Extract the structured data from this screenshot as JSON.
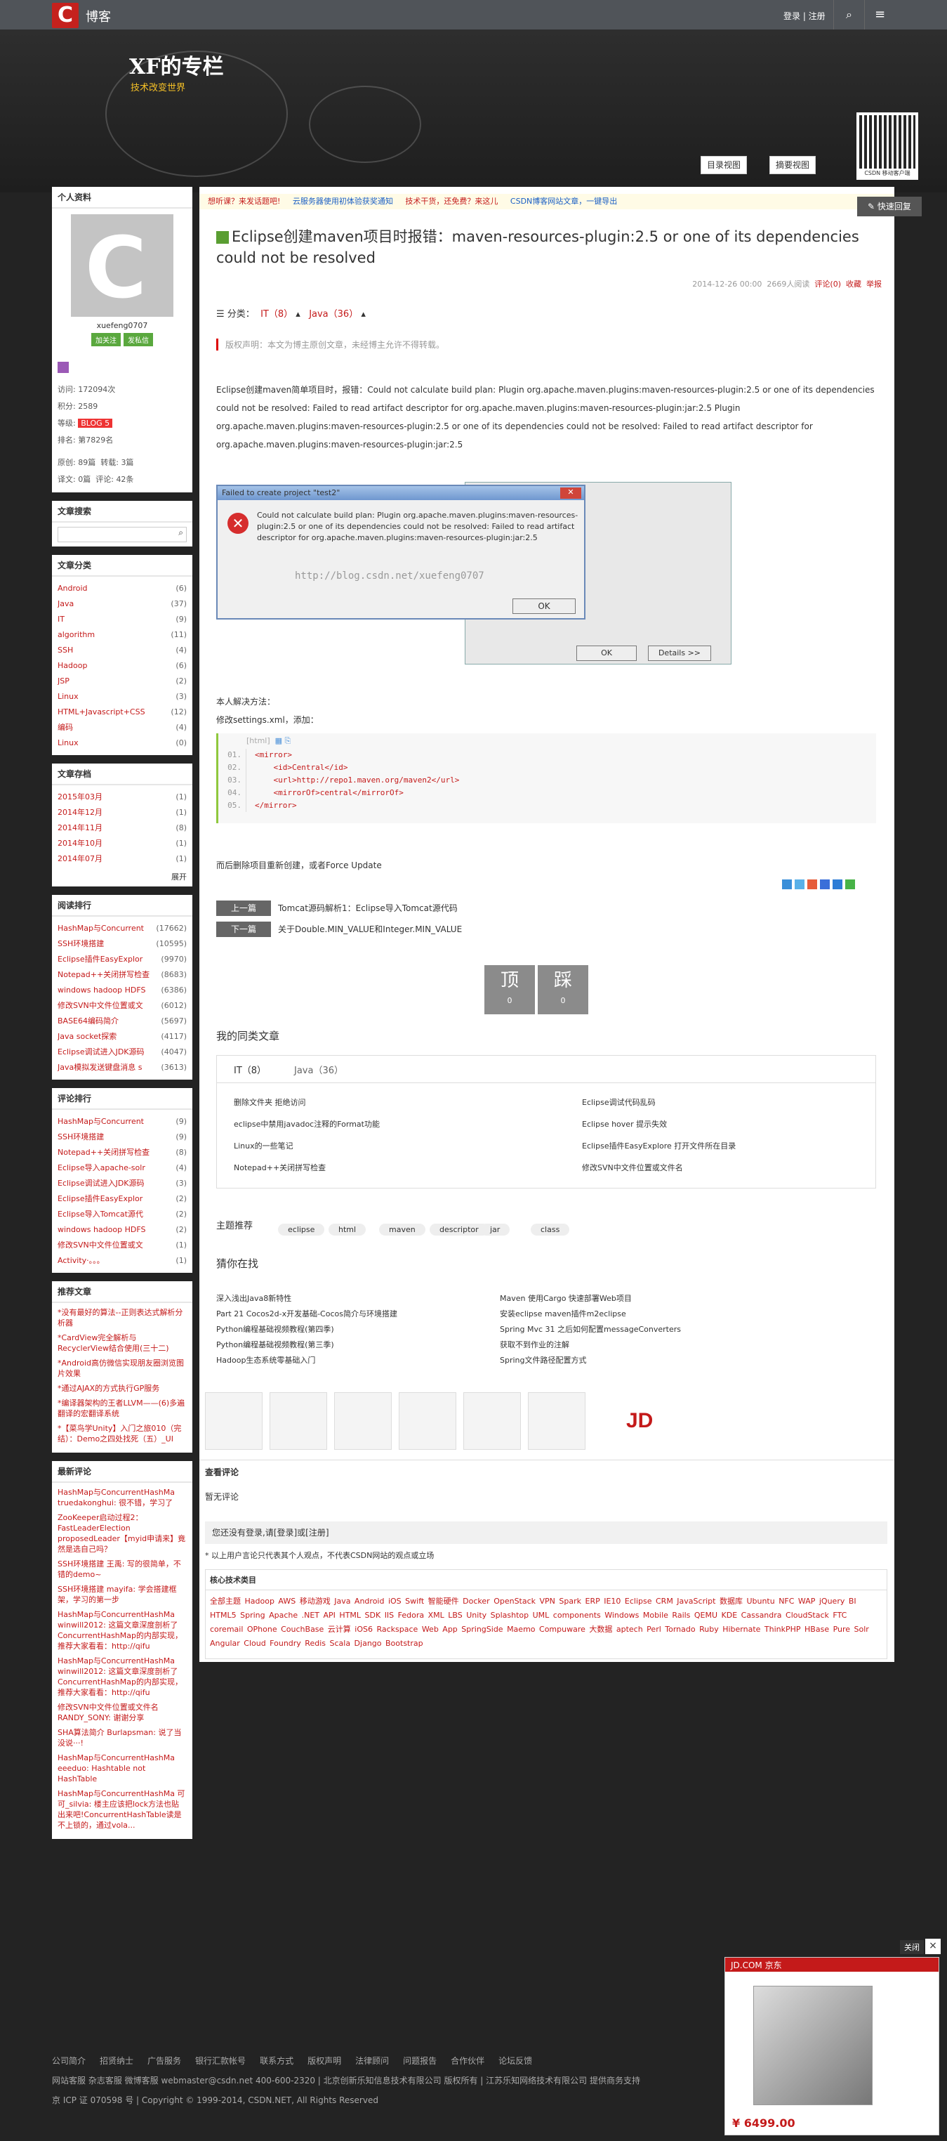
{
  "topbar": {
    "site": "博客",
    "login": "登录 | 注册",
    "search_icon": "search-icon",
    "menu_icon": "menu-icon"
  },
  "banner": {
    "title": "XF的专栏",
    "subtitle": "技术改变世界",
    "view_list": "目录视图",
    "view_summary": "摘要视图",
    "qr_caption": "CSDN 移动客户端"
  },
  "sidebar": {
    "profile": {
      "heading": "个人资料",
      "username": "xuefeng0707",
      "follow": "加关注",
      "message": "发私信",
      "visits_label": "访问:",
      "visits": "172094次",
      "points_label": "积分:",
      "points": "2589",
      "level_label": "等级:",
      "level": "BLOG 5",
      "rank_label": "排名:",
      "rank": "第7829名",
      "original_label": "原创:",
      "original": "89篇",
      "repost_label": "转载:",
      "repost": "3篇",
      "translate_label": "译文:",
      "translate": "0篇",
      "comments_label": "评论:",
      "comments": "42条"
    },
    "search": {
      "heading": "文章搜索"
    },
    "categories": {
      "heading": "文章分类",
      "items": [
        {
          "label": "Android",
          "count": "(6)"
        },
        {
          "label": "Java",
          "count": "(37)"
        },
        {
          "label": "IT",
          "count": "(9)"
        },
        {
          "label": "algorithm",
          "count": "(11)"
        },
        {
          "label": "SSH",
          "count": "(4)"
        },
        {
          "label": "Hadoop",
          "count": "(6)"
        },
        {
          "label": "JSP",
          "count": "(2)"
        },
        {
          "label": "Linux",
          "count": "(3)"
        },
        {
          "label": "HTML+Javascript+CSS",
          "count": "(12)"
        },
        {
          "label": "编码",
          "count": "(4)"
        },
        {
          "label": "Linux",
          "count": "(0)"
        }
      ]
    },
    "archive": {
      "heading": "文章存档",
      "items": [
        {
          "label": "2015年03月",
          "count": "(1)"
        },
        {
          "label": "2014年12月",
          "count": "(1)"
        },
        {
          "label": "2014年11月",
          "count": "(8)"
        },
        {
          "label": "2014年10月",
          "count": "(1)"
        },
        {
          "label": "2014年07月",
          "count": "(1)"
        }
      ],
      "expand": "展开"
    },
    "hot": {
      "heading": "阅读排行",
      "items": [
        {
          "label": "HashMap与Concurrent",
          "count": "(17662)"
        },
        {
          "label": "SSH环境搭建",
          "count": "(10595)"
        },
        {
          "label": "Eclipse插件EasyExplor",
          "count": "(9970)"
        },
        {
          "label": "Notepad++关闭拼写检查",
          "count": "(8683)"
        },
        {
          "label": "windows hadoop HDFS",
          "count": "(6386)"
        },
        {
          "label": "修改SVN中文件位置或文",
          "count": "(6012)"
        },
        {
          "label": "BASE64编码简介",
          "count": "(5697)"
        },
        {
          "label": "Java socket探索",
          "count": "(4117)"
        },
        {
          "label": "Eclipse调试进入JDK源码",
          "count": "(4047)"
        },
        {
          "label": "Java模拟发送键盘消息 s",
          "count": "(3613)"
        }
      ]
    },
    "comment_rank": {
      "heading": "评论排行",
      "items": [
        {
          "label": "HashMap与Concurrent",
          "count": "(9)"
        },
        {
          "label": "SSH环境搭建",
          "count": "(9)"
        },
        {
          "label": "Notepad++关闭拼写检查",
          "count": "(8)"
        },
        {
          "label": "Eclipse导入apache-solr",
          "count": "(4)"
        },
        {
          "label": "Eclipse调试进入JDK源码",
          "count": "(3)"
        },
        {
          "label": "Eclipse插件EasyExplor",
          "count": "(2)"
        },
        {
          "label": "Eclipse导入Tomcat源代",
          "count": "(2)"
        },
        {
          "label": "windows hadoop HDFS",
          "count": "(2)"
        },
        {
          "label": "修改SVN中文件位置或文",
          "count": "(1)"
        },
        {
          "label": "Activity·。。。",
          "count": "(1)"
        }
      ]
    },
    "recommend": {
      "heading": "推荐文章",
      "items": [
        "*没有最好的算法--正则表达式解析分析器",
        "*CardView完全解析与RecyclerView结合使用(三十二)",
        "*Android高仿微信实现朋友圈浏览图片效果",
        "*通过AJAX的方式执行GP服务",
        "*编译器架构的王者LLVM——(6)多遍翻译的宏翻译系统",
        "*【菜鸟学Unity】入门之旅010（完结）：Demo之四处找死（五）_UI"
      ]
    },
    "latest": {
      "heading": "最新评论",
      "items": [
        "HashMap与ConcurrentHashMa truedakonghui: 很不错，学习了",
        "ZooKeeper启动过程2：FastLeaderElection proposedLeader【myid申请来】竟然是选自己吗？",
        "SSH环境搭建 王禹: 写的很简单，不错的demo~",
        "SSH环境搭建 mayifa: 学会搭建框架，学习的第一步",
        "HashMap与ConcurrentHashMa winwill2012: 这篇文章深度剖析了ConcurrentHashMap的内部实现，推荐大家看看：http://qifu",
        "HashMap与ConcurrentHashMa winwill2012: 这篇文章深度剖析了ConcurrentHashMap的内部实现，推荐大家看看：http://qifu",
        "修改SVN中文件位置或文件名 RANDY_SONY: 谢谢分享",
        "SHA算法简介 Burlapsman: 说了当没说···!",
        "HashMap与ConcurrentHashMa eeeduo: Hashtable not HashTable",
        "HashMap与ConcurrentHashMa 可可_silvia: 楼主应该把lock方法也贴出来吧!ConcurrentHashTable读是不上锁的，通过vola..."
      ]
    }
  },
  "main": {
    "notice": [
      "想听课？来发话题吧!",
      "云服务器使用初体验获奖通知",
      "技术干货，还免费？来这儿",
      "CSDN博客网站文章，一键导出"
    ],
    "quick_reply": "快速回复",
    "title": "Eclipse创建maven项目时报错：maven-resources-plugin:2.5 or one of its dependencies could not be resolved",
    "meta": {
      "date": "2014-12-26 00:00",
      "views": "2669人阅读",
      "comments": "评论(0)",
      "favorite": "收藏",
      "report": "举报"
    },
    "category_label": "分类：",
    "cat1": "IT（8）",
    "cat2": "Java（36）",
    "copyright": "版权声明：本文为博主原创文章，未经博主允许不得转载。",
    "para": "Eclipse创建maven简单项目时，报错：Could not calculate build plan: Plugin org.apache.maven.plugins:maven-resources-plugin:2.5 or one of its dependencies could not be resolved: Failed to read artifact descriptor for org.apache.maven.plugins:maven-resources-plugin:jar:2.5 Plugin org.apache.maven.plugins:maven-resources-plugin:2.5 or one of its dependencies could not be resolved: Failed to read artifact descriptor for org.apache.maven.plugins:maven-resources-plugin:jar:2.5",
    "dialog": {
      "title": "Failed to create project \"test2\"",
      "text": "Could not calculate build plan: Plugin org.apache.maven.plugins:maven-resources-plugin:2.5 or one of its dependencies could not be resolved: Failed to read artifact descriptor for org.apache.maven.plugins:maven-resources-plugin:jar:2.5",
      "watermark": "http://blog.csdn.net/xuefeng0707",
      "ok": "OK",
      "back_ok": "OK",
      "details": "Details >>"
    },
    "solution": "本人解决方法：",
    "solution2": "修改settings.xml，添加：",
    "code_head": "[html]",
    "code": [
      "<mirror>",
      "    <id>Central</id>",
      "    <url>http://repo1.maven.org/maven2</url>",
      "    <mirrorOf>central</mirrorOf>",
      "</mirror>"
    ],
    "code_nums": [
      "01.",
      "02.",
      "03.",
      "04.",
      "05."
    ],
    "after": "而后删除项目重新创建，或者Force Update",
    "prev_label": "上一篇",
    "prev": "Tomcat源码解析1：Eclipse导入Tomcat源代码",
    "next_label": "下一篇",
    "next": "关于Double.MIN_VALUE和Integer.MIN_VALUE",
    "vote_up": "顶",
    "vote_up_n": "0",
    "vote_down": "踩",
    "vote_down_n": "0",
    "same_title": "我的同类文章",
    "same_tab1": "IT（8）",
    "same_tab2": "Java（36）",
    "same_left": [
      "删除文件夹 拒绝访问",
      "eclipse中禁用javadoc注释的Format功能",
      "Linux的一些笔记",
      "Notepad++关闭拼写检查"
    ],
    "same_right": [
      "Eclipse调试代码乱码",
      "Eclipse hover 提示失效",
      "Eclipse插件EasyExplore 打开文件所在目录",
      "修改SVN中文件位置或文件名"
    ],
    "topic": "主题推荐",
    "topics": [
      "eclipse",
      "html",
      "maven",
      "descriptor",
      "jar",
      "class"
    ],
    "guess_title": "猜你在找",
    "guess_left": [
      "深入浅出Java8新特性",
      "Part 21 Cocos2d-x开发基础-Cocos简介与环境搭建",
      "Python编程基础视频教程(第四季)",
      "Python编程基础视频教程(第三季)",
      "Hadoop生态系统零基础入门"
    ],
    "guess_right": [
      "Maven 使用Cargo 快速部署Web项目",
      "安装eclipse maven插件m2eclipse",
      "Spring Mvc 31 之后如何配置messageConverters",
      "获取不到作业的注解",
      "Spring文件路径配置方式"
    ],
    "comments_heading": "查看评论",
    "no_comments": "暂无评论",
    "login_bar": "您还没有登录,请[登录]或[注册]",
    "disclaimer": "* 以上用户言论只代表其个人观点，不代表CSDN网站的观点或立场",
    "tech_heading": "核心技术类目",
    "tech": "全部主题 Hadoop AWS 移动游戏 Java Android iOS Swift 智能硬件 Docker OpenStack VPN Spark ERP IE10 Eclipse CRM JavaScript 数据库 Ubuntu NFC WAP jQuery BI HTML5 Spring Apache .NET API HTML SDK IIS Fedora XML LBS Unity Splashtop UML components Windows Mobile Rails QEMU KDE Cassandra CloudStack FTC coremail OPhone CouchBase 云计算 iOS6 Rackspace Web App SpringSide Maemo Compuware 大数据 aptech Perl Tornado Ruby Hibernate ThinkPHP HBase Pure Solr Angular Cloud Foundry Redis Scala Django Bootstrap"
  },
  "footer": {
    "line1": [
      "公司简介",
      "招贤纳士",
      "广告服务",
      "银行汇款帐号",
      "联系方式",
      "版权声明",
      "法律顾问",
      "问题报告",
      "合作伙伴",
      "论坛反馈"
    ],
    "line2": "网站客服  杂志客服  微博客服  webmaster@csdn.net  400-600-2320 | 北京创新乐知信息技术有限公司 版权所有 | 江苏乐知网络技术有限公司 提供商务支持",
    "line3": "京 ICP 证 070598 号 | Copyright © 1999-2014, CSDN.NET, All Rights Reserved"
  },
  "jd_ad": {
    "header": "JD.COM 京东",
    "price": "¥ 6499.00",
    "close": "关闭",
    "close_x": "×"
  }
}
